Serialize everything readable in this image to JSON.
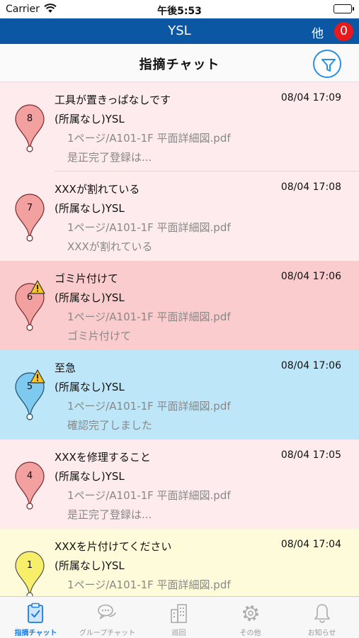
{
  "status_bar": {
    "carrier": "Carrier",
    "time": "午後5:53"
  },
  "app_bar": {
    "title": "YSL",
    "other_label": "他",
    "badge_count": "0"
  },
  "page": {
    "title": "指摘チャット"
  },
  "colors": {
    "header_blue": "#0c57a3",
    "badge_red": "#e8191c",
    "row_pink": "#feebee",
    "row_red": "#fbcccd",
    "row_blue": "#bde7f8",
    "row_yellow": "#fdfbd9",
    "accent_blue": "#1a7fe0"
  },
  "items": [
    {
      "pin_number": "8",
      "pin_color": "#f2a0a0",
      "warning": false,
      "title": "工具が置きっぱなしです",
      "time": "08/04 17:09",
      "author": "(所属なし)YSL",
      "file": "1ページ/A101-1F 平面詳細図.pdf",
      "message": "是正完了登録は..."
    },
    {
      "pin_number": "7",
      "pin_color": "#f2a0a0",
      "warning": false,
      "title": "XXXが割れている",
      "time": "08/04 17:08",
      "author": "(所属なし)YSL",
      "file": "1ページ/A101-1F 平面詳細図.pdf",
      "message": "XXXが割れている"
    },
    {
      "pin_number": "6",
      "pin_color": "#f2a0a0",
      "warning": true,
      "title": "ゴミ片付けて",
      "time": "08/04 17:06",
      "author": "(所属なし)YSL",
      "file": "1ページ/A101-1F 平面詳細図.pdf",
      "message": "ゴミ片付けて"
    },
    {
      "pin_number": "5",
      "pin_color": "#7ec9ef",
      "warning": true,
      "title": "至急",
      "time": "08/04 17:06",
      "author": "(所属なし)YSL",
      "file": "1ページ/A101-1F 平面詳細図.pdf",
      "message": "確認完了しました"
    },
    {
      "pin_number": "4",
      "pin_color": "#f2a0a0",
      "warning": false,
      "title": "XXXを修理すること",
      "time": "08/04 17:05",
      "author": "(所属なし)YSL",
      "file": "1ページ/A101-1F 平面詳細図.pdf",
      "message": "是正完了登録は..."
    },
    {
      "pin_number": "1",
      "pin_color": "#f7ee6a",
      "warning": false,
      "title": "XXXを片付けてください",
      "time": "08/04 17:04",
      "author": "(所属なし)YSL",
      "file": "1ページ/A101-1F 平面詳細図.pdf",
      "message": ""
    }
  ],
  "tabs": [
    {
      "label": "指摘チャット",
      "icon": "clipboard-check-icon",
      "active": true
    },
    {
      "label": "グループチャット",
      "icon": "chat-bubbles-icon",
      "active": false
    },
    {
      "label": "巡回",
      "icon": "buildings-icon",
      "active": false
    },
    {
      "label": "その他",
      "icon": "gear-icon",
      "active": false
    },
    {
      "label": "お知らせ",
      "icon": "bell-icon",
      "active": false
    }
  ]
}
